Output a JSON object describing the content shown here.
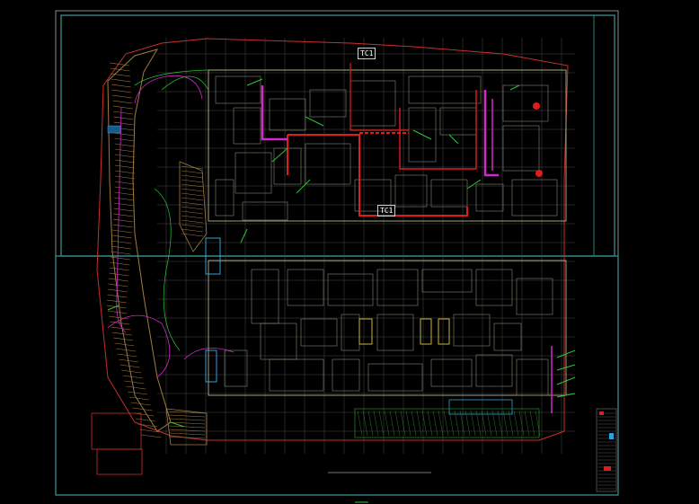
{
  "drawing": {
    "tag_tc": "TC1",
    "tag_tc_lower": "TC1",
    "bottom_center_label": "",
    "scale_note": ""
  },
  "colors": {
    "background": "#000000",
    "frame": "#3a9a9a",
    "outer_frame": "#9a9a9a",
    "grid": "#4a4a4a",
    "walls": "#b8b088",
    "red_zone": "#e11c1c",
    "magenta": "#d428c8",
    "green": "#2ec43a",
    "tan": "#a07a40",
    "cyan": "#34a0d8",
    "yellow": "#c8b43a"
  }
}
